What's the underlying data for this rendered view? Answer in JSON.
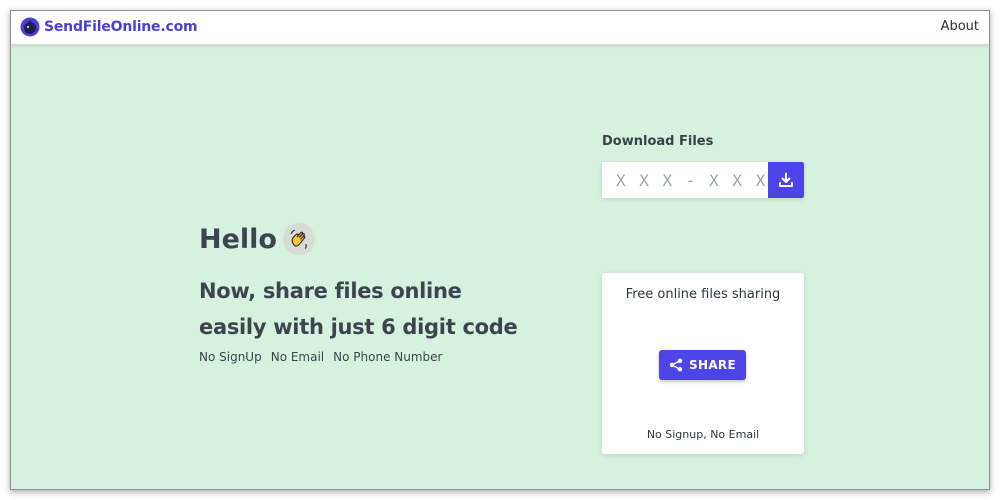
{
  "header": {
    "brand": "SendFileOnline.com",
    "about": "About",
    "brand_color": "#4c3fd8"
  },
  "hero": {
    "greeting": "Hello",
    "greeting_icon": "waving-hand-icon",
    "subtitle_line1": "Now, share files online",
    "subtitle_line2": "easily with just 6 digit code",
    "features": [
      "No SignUp",
      "No Email",
      "No Phone Number"
    ]
  },
  "download": {
    "heading": "Download Files",
    "placeholder": "X X X - X X X",
    "button_icon": "download-icon"
  },
  "share": {
    "title": "Free online files sharing",
    "button_label": "SHARE",
    "button_icon": "share-icon",
    "footer": "No Signup, No Email"
  },
  "colors": {
    "background": "#d4f2de",
    "accent": "#4c44e6",
    "text": "#3c4450"
  }
}
